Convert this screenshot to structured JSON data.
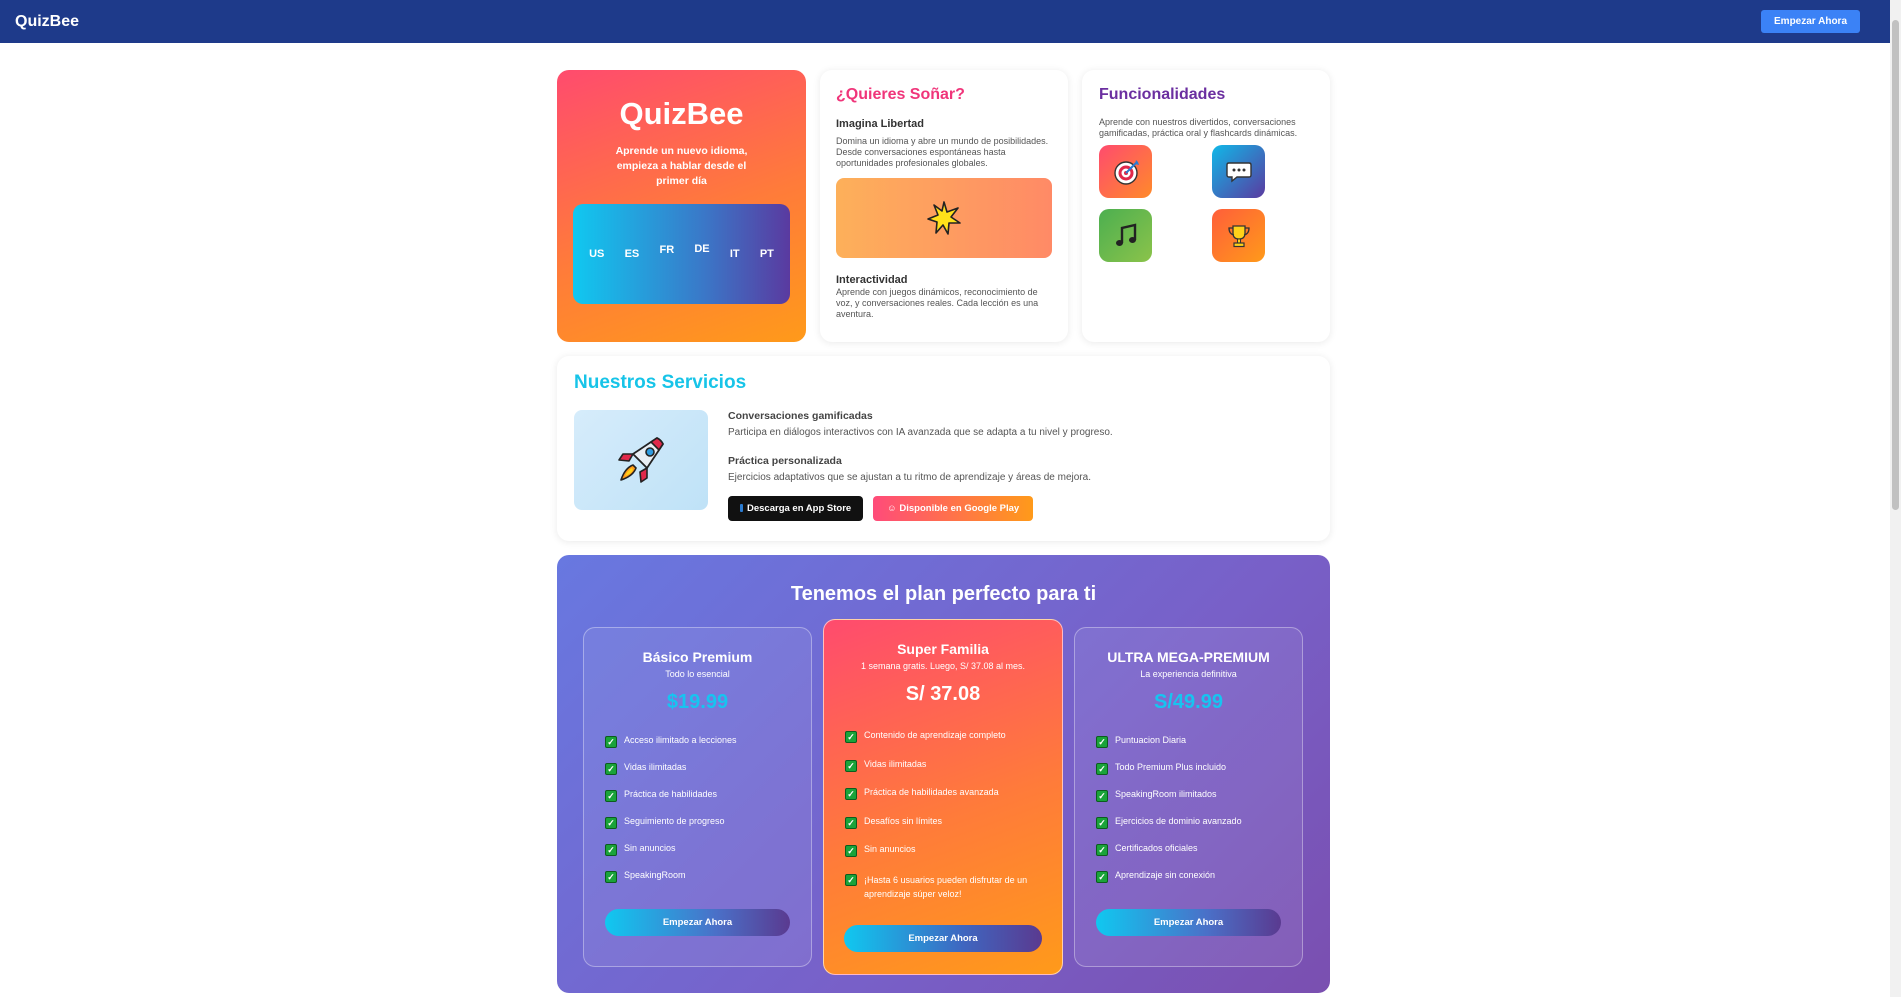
{
  "header": {
    "brand": "QuizBee",
    "cta": "Empezar Ahora"
  },
  "hero": {
    "title": "QuizBee",
    "tagline": "Aprende un nuevo idioma, empieza a hablar desde el primer día",
    "languages": [
      "US",
      "ES",
      "FR",
      "DE",
      "IT",
      "PT"
    ]
  },
  "dream": {
    "title": "¿Quieres Soñar?",
    "subtitle1": "Imagina Libertad",
    "text1": "Domina un idioma y abre un mundo de posibilidades. Desde conversaciones espontáneas hasta oportunidades profesionales globales.",
    "subtitle2": "Interactividad",
    "text2": "Aprende con juegos dinámicos, reconocimiento de voz, y conversaciones reales. Cada lección es una aventura."
  },
  "features": {
    "title": "Funcionalidades",
    "text": "Aprende con nuestros divertidos, conversaciones gamificadas, práctica oral y flashcards dinámicas.",
    "icons": [
      "target-icon",
      "speech-bubble-icon",
      "music-note-icon",
      "trophy-icon"
    ]
  },
  "services": {
    "title": "Nuestros Servicios",
    "items": [
      {
        "title": "Conversaciones gamificadas",
        "text": "Participa en diálogos interactivos con IA avanzada que se adapta a tu nivel y progreso."
      },
      {
        "title": "Práctica personalizada",
        "text": "Ejercicios adaptativos que se ajustan a tu ritmo de aprendizaje y áreas de mejora."
      }
    ],
    "app_store": "Descarga en App Store",
    "google_play": "Disponible en Google Play"
  },
  "plans": {
    "title": "Tenemos el plan perfecto para ti",
    "items": [
      {
        "name": "Básico Premium",
        "sub": "Todo lo esencial",
        "price": "$19.99",
        "features": [
          "Acceso ilimitado a lecciones",
          "Vidas ilimitadas",
          "Práctica de habilidades",
          "Seguimiento de progreso",
          "Sin anuncios",
          "SpeakingRoom"
        ],
        "cta": "Empezar Ahora"
      },
      {
        "name": "Super Familia",
        "sub": "1 semana gratis. Luego, S/ 37.08 al mes.",
        "price": "S/ 37.08",
        "features": [
          "Contenido de aprendizaje completo",
          "Vidas ilimitadas",
          "Práctica de habilidades avanzada",
          "Desafíos sin límites",
          "Sin anuncios",
          "¡Hasta 6 usuarios pueden disfrutar de un aprendizaje súper veloz!"
        ],
        "cta": "Empezar Ahora"
      },
      {
        "name": "ULTRA MEGA-PREMIUM",
        "sub": "La experiencia definitiva",
        "price": "S/49.99",
        "features": [
          "Puntuacion Diaria",
          "Todo Premium Plus incluido",
          "SpeakingRoom ilimitados",
          "Ejercicios de dominio avanzado",
          "Certificados oficiales",
          "Aprendizaje sin conexión"
        ],
        "cta": "Empezar Ahora"
      }
    ]
  },
  "colors": {
    "header": "#1e3a8a",
    "accent_blue": "#3b82f6",
    "accent_cyan": "#17c4e8",
    "accent_pink": "#f0357a",
    "accent_purple": "#6b2fa0"
  }
}
